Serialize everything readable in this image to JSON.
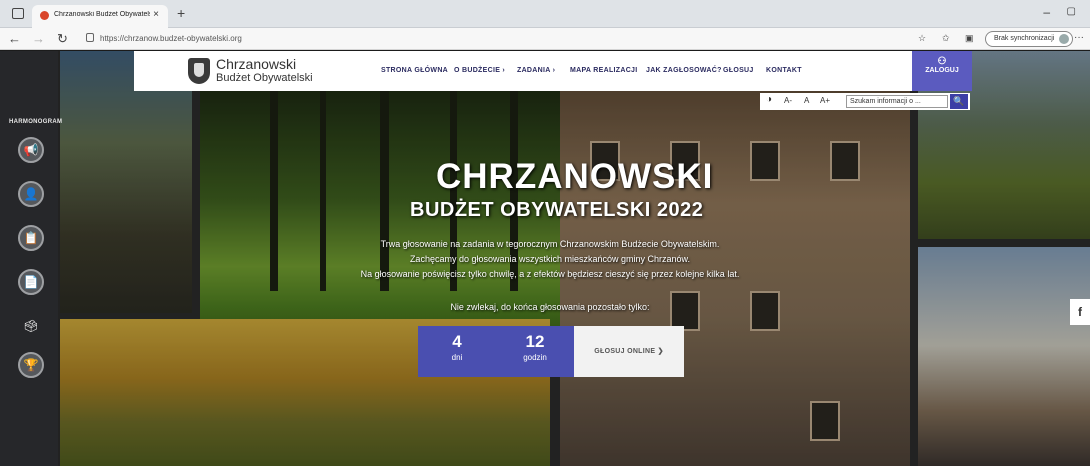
{
  "browser": {
    "tab_title": "Chrzanowski Budżet Obywatelski",
    "tab_close": "×",
    "new_tab": "+",
    "url": "https://chrzanow.budzet-obywatelski.org",
    "sync_label": "Brak synchronizacji",
    "win_minimize": "–",
    "win_maximize": "▢",
    "back": "←",
    "forward": "→",
    "reload": "↻",
    "more": "···"
  },
  "header": {
    "logo_line1": "Chrzanowski",
    "logo_line2": "Budżet Obywatelski",
    "nav": [
      {
        "label": "STRONA GŁÓWNA"
      },
      {
        "label": "O BUDŻECIE ›"
      },
      {
        "label": "ZADANIA ›"
      },
      {
        "label": "MAPA REALIZACJI"
      },
      {
        "label": "JAK ZAGŁOSOWAĆ?"
      },
      {
        "label": "GŁOSUJ"
      },
      {
        "label": "KONTAKT"
      }
    ],
    "login_label": "ZALOGUJ"
  },
  "accessibility": {
    "contrast": "◑",
    "font_small": "A-",
    "font_normal": "A",
    "font_large": "A+",
    "search_placeholder": "Szukam informacji o ...",
    "search_btn": "🔍"
  },
  "sidebar": {
    "title": "HARMONOGRAM"
  },
  "hero": {
    "title": "CHRZANOWSKI",
    "subtitle": "BUDŻET OBYWATELSKI 2022",
    "lines": [
      "Trwa głosowanie na zadania w tegorocznym Chrzanowskim Budżecie Obywatelskim.",
      "Zachęcamy do głosowania wszystkich mieszkańców gminy Chrzanów.",
      "Na głosowanie poświęcisz tylko chwilę, a z efektów będziesz cieszyć się przez kolejne kilka lat."
    ],
    "reminder": "Nie zwlekaj, do końca głosowania pozostało tylko:"
  },
  "countdown": {
    "days_value": "4",
    "days_label": "dni",
    "hours_value": "12",
    "hours_label": "godzin",
    "vote_online": "GŁOSUJ ONLINE ❯"
  },
  "social": {
    "facebook": "f"
  }
}
